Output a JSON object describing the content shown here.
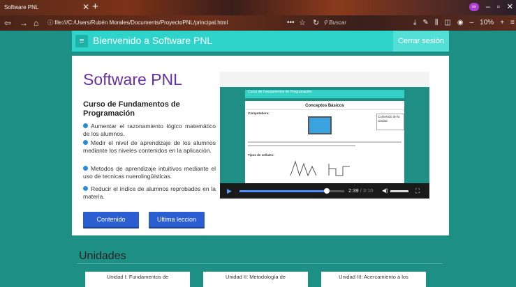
{
  "browser": {
    "tab_title": "Software PNL",
    "tab_close": "✕",
    "tab_new": "+",
    "url": "file:///C:/Users/Rubén Morales/Documents/ProyectoPNL/principal.html",
    "url_more": "•••",
    "search_placeholder": "Buscar",
    "zoom": "10%"
  },
  "header": {
    "title": "Bienvenido a Software PNL",
    "logout": "Cerrar sesión"
  },
  "hero": {
    "app_title": "Software PNL",
    "course_title": "Curso de Fundamentos de Programación",
    "bullets": [
      "Aumentar el razonamiento lógico matemático de los alumnos.",
      "Medir el nivel de aprendizaje de los alumnos mediante los niveles contenidos en la aplicación.",
      "Metodos de aprendizaje intuitivos mediante el uso de tecnicas nuerolingüisticas.",
      "Reducir el índice de alumnos reprobados en la materia."
    ],
    "buttons": {
      "content": "Contenido",
      "last_lesson": "Ultima leccion"
    }
  },
  "video": {
    "inner_title": "Curso de Fundamentos de Programación",
    "section": "Conceptos Básicos",
    "sub1": "Computadora:",
    "note": "Contenido de la unidad",
    "sub2": "Tipos de señales:",
    "time_current": "2:39",
    "time_total": " / 3:10",
    "progress": 0.83
  },
  "units": {
    "title": "Unidades",
    "cards": [
      "Unidad I: Fundamentos de",
      "Unidad II: Metodología de",
      "Unidad III: Acercamiento a los"
    ]
  }
}
